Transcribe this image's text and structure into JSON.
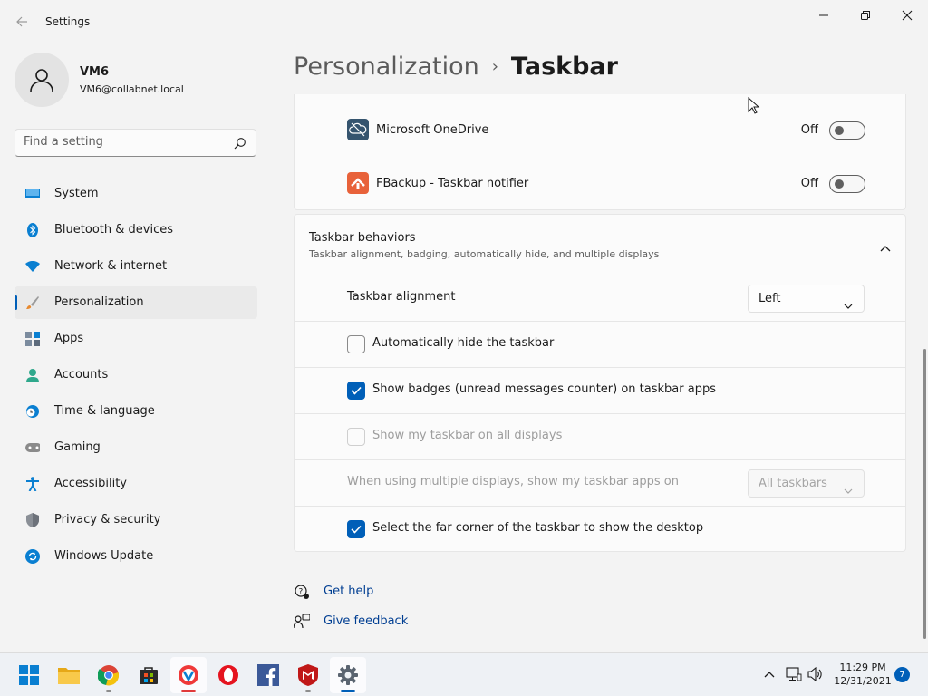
{
  "window": {
    "title": "Settings",
    "back_icon": "back-arrow-icon",
    "controls": [
      "minimize-icon",
      "maximize-icon",
      "close-icon"
    ]
  },
  "profile": {
    "name": "VM6",
    "email": "VM6@collabnet.local"
  },
  "search": {
    "placeholder": "Find a setting"
  },
  "sidebar": {
    "items": [
      {
        "label": "System",
        "icon": "system-icon",
        "active": false
      },
      {
        "label": "Bluetooth & devices",
        "icon": "bluetooth-icon",
        "active": false
      },
      {
        "label": "Network & internet",
        "icon": "wifi-icon",
        "active": false
      },
      {
        "label": "Personalization",
        "icon": "brush-icon",
        "active": true
      },
      {
        "label": "Apps",
        "icon": "apps-icon",
        "active": false
      },
      {
        "label": "Accounts",
        "icon": "accounts-icon",
        "active": false
      },
      {
        "label": "Time & language",
        "icon": "clock-globe-icon",
        "active": false
      },
      {
        "label": "Gaming",
        "icon": "gamepad-icon",
        "active": false
      },
      {
        "label": "Accessibility",
        "icon": "accessibility-icon",
        "active": false
      },
      {
        "label": "Privacy & security",
        "icon": "shield-icon",
        "active": false
      },
      {
        "label": "Windows Update",
        "icon": "update-icon",
        "active": false
      }
    ]
  },
  "breadcrumb": {
    "parent": "Personalization",
    "separator": "›",
    "current": "Taskbar"
  },
  "tray_apps": [
    {
      "label": "Microsoft OneDrive",
      "icon": "onedrive-icon",
      "state": "Off",
      "on": false
    },
    {
      "label": "FBackup - Taskbar notifier",
      "icon": "fbackup-icon",
      "state": "Off",
      "on": false
    }
  ],
  "behaviors": {
    "title": "Taskbar behaviors",
    "subtitle": "Taskbar alignment, badging, automatically hide, and multiple displays",
    "alignment": {
      "label": "Taskbar alignment",
      "value": "Left"
    },
    "auto_hide": {
      "label": "Automatically hide the taskbar",
      "checked": false
    },
    "badges": {
      "label": "Show badges (unread messages counter) on taskbar apps",
      "checked": true
    },
    "all_displays": {
      "label": "Show my taskbar on all displays",
      "checked": false,
      "disabled": true
    },
    "multi_display": {
      "label": "When using multiple displays, show my taskbar apps on",
      "value": "All taskbars",
      "disabled": true
    },
    "far_corner": {
      "label": "Select the far corner of the taskbar to show the desktop",
      "checked": true
    }
  },
  "help": {
    "get_help": "Get help",
    "give_feedback": "Give feedback"
  },
  "taskbar": {
    "apps": [
      "start-icon",
      "file-explorer-icon",
      "chrome-icon",
      "store-icon",
      "vivaldi-icon",
      "opera-icon",
      "facebook-icon",
      "mcafee-icon",
      "settings-icon"
    ],
    "time": "11:29 PM",
    "date": "12/31/2021",
    "notifications": "7"
  },
  "colors": {
    "accent": "#005fb8",
    "background": "#f3f3f3",
    "card": "#fbfbfb"
  }
}
